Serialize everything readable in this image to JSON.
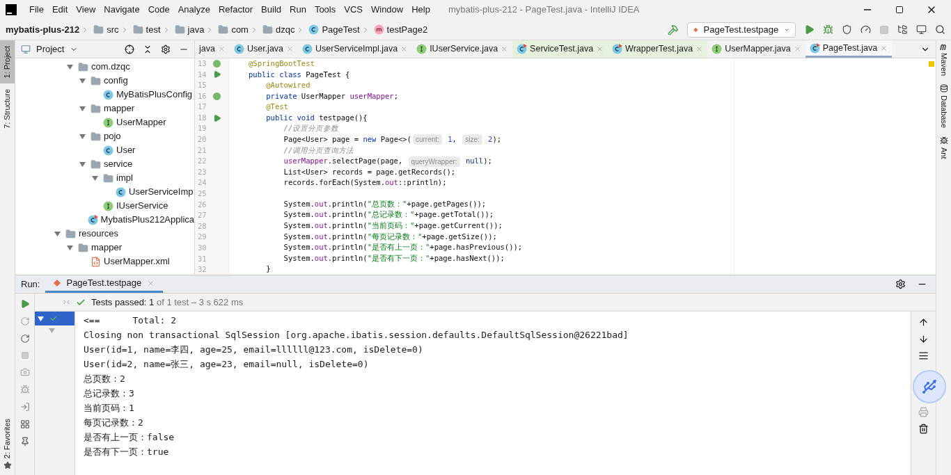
{
  "window": {
    "title": "mybatis-plus-212 - PageTest.java - IntelliJ IDEA"
  },
  "menu": [
    "File",
    "Edit",
    "View",
    "Navigate",
    "Code",
    "Analyze",
    "Refactor",
    "Build",
    "Run",
    "Tools",
    "VCS",
    "Window",
    "Help"
  ],
  "breadcrumbs": [
    {
      "kind": "project",
      "label": "mybatis-plus-212"
    },
    {
      "kind": "folder",
      "label": "src"
    },
    {
      "kind": "folder",
      "label": "test"
    },
    {
      "kind": "folder",
      "label": "java"
    },
    {
      "kind": "folder",
      "label": "com"
    },
    {
      "kind": "folder",
      "label": "dzqc"
    },
    {
      "kind": "class",
      "label": "PageTest"
    },
    {
      "kind": "method",
      "label": "testPage2"
    }
  ],
  "run_config": "PageTest.testpage",
  "left_stripe": [
    {
      "label": "1: Project",
      "selected": true
    },
    {
      "label": "7: Structure",
      "selected": false
    }
  ],
  "favorites": "2: Favorites",
  "right_stripe": [
    {
      "kind": "maven",
      "label": "Maven"
    },
    {
      "kind": "database",
      "label": "Database"
    },
    {
      "kind": "ant",
      "label": "Ant"
    }
  ],
  "project_panel": {
    "title": "Project"
  },
  "tree": [
    {
      "kind": "package",
      "label": "com.dzqc",
      "expanded": true,
      "children": [
        {
          "kind": "package",
          "label": "config",
          "expanded": true,
          "children": [
            {
              "kind": "class",
              "label": "MyBatisPlusConfig"
            }
          ]
        },
        {
          "kind": "package",
          "label": "mapper",
          "expanded": true,
          "children": [
            {
              "kind": "interface",
              "label": "UserMapper"
            }
          ]
        },
        {
          "kind": "package",
          "label": "pojo",
          "expanded": true,
          "children": [
            {
              "kind": "class",
              "label": "User"
            }
          ]
        },
        {
          "kind": "package",
          "label": "service",
          "expanded": true,
          "children": [
            {
              "kind": "package",
              "label": "impl",
              "expanded": true,
              "children": [
                {
                  "kind": "class",
                  "label": "UserServiceImp"
                }
              ]
            },
            {
              "kind": "interface",
              "label": "IUserService"
            }
          ]
        },
        {
          "kind": "app",
          "label": "MybatisPlus212Applica"
        }
      ]
    },
    {
      "kind": "resources",
      "label": "resources",
      "expanded": true,
      "children": [
        {
          "kind": "folder",
          "label": "mapper",
          "expanded": true,
          "children": [
            {
              "kind": "xml",
              "label": "UserMapper.xml"
            }
          ]
        }
      ]
    }
  ],
  "tabs": [
    {
      "kind": "plain",
      "label": "java",
      "selected": false
    },
    {
      "kind": "class",
      "label": "User.java",
      "selected": false
    },
    {
      "kind": "class",
      "label": "UserServiceImpl.java",
      "selected": false
    },
    {
      "kind": "interface",
      "label": "IUserService.java",
      "selected": false
    },
    {
      "kind": "test",
      "label": "ServiceTest.java",
      "selected": false
    },
    {
      "kind": "test",
      "label": "WrapperTest.java",
      "selected": false
    },
    {
      "kind": "interface",
      "label": "UserMapper.java",
      "selected": false
    },
    {
      "kind": "test",
      "label": "PageTest.java",
      "selected": true
    }
  ],
  "code": [
    {
      "number": "13",
      "kind": "bean",
      "segments": [
        {
          "kind": "annotation",
          "text": "@SpringBootTest"
        }
      ]
    },
    {
      "number": "14",
      "kind": "run",
      "segments": [
        {
          "kind": "keyword",
          "text": "public class "
        },
        {
          "kind": "plain",
          "text": "PageTest {"
        }
      ]
    },
    {
      "number": "15",
      "segments": [
        {
          "kind": "annotation",
          "text": "    @Autowired"
        }
      ]
    },
    {
      "number": "16",
      "kind": "bean",
      "segments": [
        {
          "kind": "keyword",
          "text": "    private "
        },
        {
          "kind": "plain",
          "text": "UserMapper "
        },
        {
          "kind": "field",
          "text": "userMapper"
        },
        {
          "kind": "plain",
          "text": ";"
        }
      ]
    },
    {
      "number": "17",
      "segments": [
        {
          "kind": "annotation",
          "text": "    @Test"
        }
      ]
    },
    {
      "number": "18",
      "kind": "run",
      "segments": [
        {
          "kind": "keyword",
          "text": "    public void "
        },
        {
          "kind": "plain",
          "text": "testpage(){"
        }
      ]
    },
    {
      "number": "19",
      "segments": [
        {
          "kind": "comment",
          "text": "        //设置分页参数"
        }
      ]
    },
    {
      "number": "20",
      "segments": [
        {
          "kind": "plain",
          "text": "        Page<User> page = "
        },
        {
          "kind": "keyword",
          "text": "new "
        },
        {
          "kind": "plain",
          "text": "Page<>("
        },
        {
          "kind": "hint",
          "text": "current:"
        },
        {
          "kind": "number",
          "text": " 1"
        },
        {
          "kind": "plain",
          "text": ", "
        },
        {
          "kind": "hint",
          "text": "size:"
        },
        {
          "kind": "number",
          "text": " 2"
        },
        {
          "kind": "plain",
          "text": ");"
        }
      ]
    },
    {
      "number": "21",
      "segments": [
        {
          "kind": "comment",
          "text": "        //调用分页查询方法"
        }
      ]
    },
    {
      "number": "22",
      "segments": [
        {
          "kind": "field",
          "text": "        userMapper"
        },
        {
          "kind": "plain",
          "text": ".selectPage(page, "
        },
        {
          "kind": "hint",
          "text": "queryWrapper:"
        },
        {
          "kind": "keyword",
          "text": " null"
        },
        {
          "kind": "plain",
          "text": ");"
        }
      ]
    },
    {
      "number": "23",
      "segments": [
        {
          "kind": "plain",
          "text": "        List<User> records = page.getRecords();"
        }
      ]
    },
    {
      "number": "24",
      "segments": [
        {
          "kind": "plain",
          "text": "        records.forEach(System."
        },
        {
          "kind": "field",
          "text": "out"
        },
        {
          "kind": "plain",
          "text": "::println);"
        }
      ]
    },
    {
      "number": "25"
    },
    {
      "number": "26",
      "segments": [
        {
          "kind": "plain",
          "text": "        System."
        },
        {
          "kind": "field",
          "text": "out"
        },
        {
          "kind": "plain",
          "text": ".println("
        },
        {
          "kind": "string",
          "text": "\"总页数：\""
        },
        {
          "kind": "plain",
          "text": "+page.getPages());"
        }
      ]
    },
    {
      "number": "27",
      "segments": [
        {
          "kind": "plain",
          "text": "        System."
        },
        {
          "kind": "field",
          "text": "out"
        },
        {
          "kind": "plain",
          "text": ".println("
        },
        {
          "kind": "string",
          "text": "\"总记录数：\""
        },
        {
          "kind": "plain",
          "text": "+page.getTotal());"
        }
      ]
    },
    {
      "number": "28",
      "segments": [
        {
          "kind": "plain",
          "text": "        System."
        },
        {
          "kind": "field",
          "text": "out"
        },
        {
          "kind": "plain",
          "text": ".println("
        },
        {
          "kind": "string",
          "text": "\"当前页码：\""
        },
        {
          "kind": "plain",
          "text": "+page.getCurrent());"
        }
      ]
    },
    {
      "number": "29",
      "segments": [
        {
          "kind": "plain",
          "text": "        System."
        },
        {
          "kind": "field",
          "text": "out"
        },
        {
          "kind": "plain",
          "text": ".println("
        },
        {
          "kind": "string",
          "text": "\"每页记录数：\""
        },
        {
          "kind": "plain",
          "text": "+page.getSize());"
        }
      ]
    },
    {
      "number": "30",
      "segments": [
        {
          "kind": "plain",
          "text": "        System."
        },
        {
          "kind": "field",
          "text": "out"
        },
        {
          "kind": "plain",
          "text": ".println("
        },
        {
          "kind": "string",
          "text": "\"是否有上一页：\""
        },
        {
          "kind": "plain",
          "text": "+page.hasPrevious());"
        }
      ]
    },
    {
      "number": "31",
      "segments": [
        {
          "kind": "plain",
          "text": "        System."
        },
        {
          "kind": "field",
          "text": "out"
        },
        {
          "kind": "plain",
          "text": ".println("
        },
        {
          "kind": "string",
          "text": "\"是否有下一页：\""
        },
        {
          "kind": "plain",
          "text": "+page.hasNext());"
        }
      ]
    },
    {
      "number": "32",
      "segments": [
        {
          "kind": "plain",
          "text": "    }"
        }
      ]
    }
  ],
  "run": {
    "label": "Run:",
    "tab": "PageTest.testpage",
    "status": {
      "passed": "Tests passed: 1",
      "rest": "of 1 test – 3 s 622 ms"
    },
    "console": [
      "<==      Total: 2",
      "Closing non transactional SqlSession [org.apache.ibatis.session.defaults.DefaultSqlSession@26221bad]",
      "User(id=1, name=李四, age=25, email=llllll@123.com, isDelete=0)",
      "User(id=2, name=张三, age=23, email=null, isDelete=0)",
      "总页数：2",
      "总记录数：3",
      "当前页码：1",
      "每页记录数：2",
      "是否有上一页：false",
      "是否有下一页：true"
    ]
  }
}
